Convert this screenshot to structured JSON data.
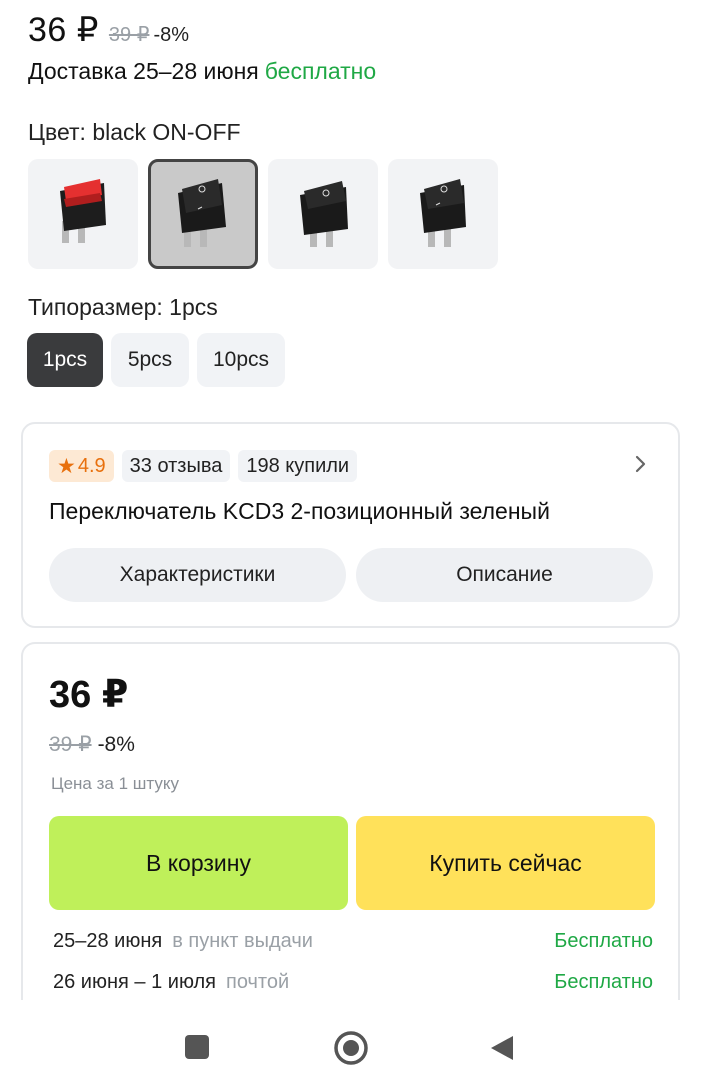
{
  "top": {
    "price": "36 ₽",
    "old_price": "39 ₽",
    "discount": "-8%",
    "delivery_text": "Доставка 25–28 июня",
    "delivery_free": "бесплатно"
  },
  "color": {
    "label": "Цвет: black ON-OFF",
    "options": [
      {
        "name": "red ON-OFF",
        "icon": "red-rocker-switch"
      },
      {
        "name": "black ON-OFF",
        "icon": "black-rocker-switch",
        "selected": true
      },
      {
        "name": "black O-I",
        "icon": "black-rocker-switch"
      },
      {
        "name": "black I-O",
        "icon": "black-rocker-switch"
      }
    ]
  },
  "size": {
    "label": "Типоразмер: 1pcs",
    "options": [
      "1pcs",
      "5pcs",
      "10pcs"
    ],
    "selected": "1pcs"
  },
  "info_card": {
    "rating": "4.9",
    "reviews": "33 отзыва",
    "bought": "198 купили",
    "title": "Переключатель KCD3 2-позиционный зеленый",
    "tab_specs": "Характеристики",
    "tab_description": "Описание"
  },
  "buy_card": {
    "price": "36 ₽",
    "old_price": "39 ₽",
    "discount": "-8%",
    "per_unit": "Цена за 1 штуку",
    "cart_button": "В корзину",
    "buy_button": "Купить сейчас",
    "delivery": [
      {
        "date": "25–28 июня",
        "method": "в пункт выдачи",
        "price": "Бесплатно"
      },
      {
        "date": "26 июня – 1 июля",
        "method": "почтой",
        "price": "Бесплатно"
      }
    ]
  },
  "colors": {
    "free_green": "#1fa845",
    "cart_green": "#bff05a",
    "buy_yellow": "#ffe15a",
    "rating_orange": "#e8700d"
  }
}
